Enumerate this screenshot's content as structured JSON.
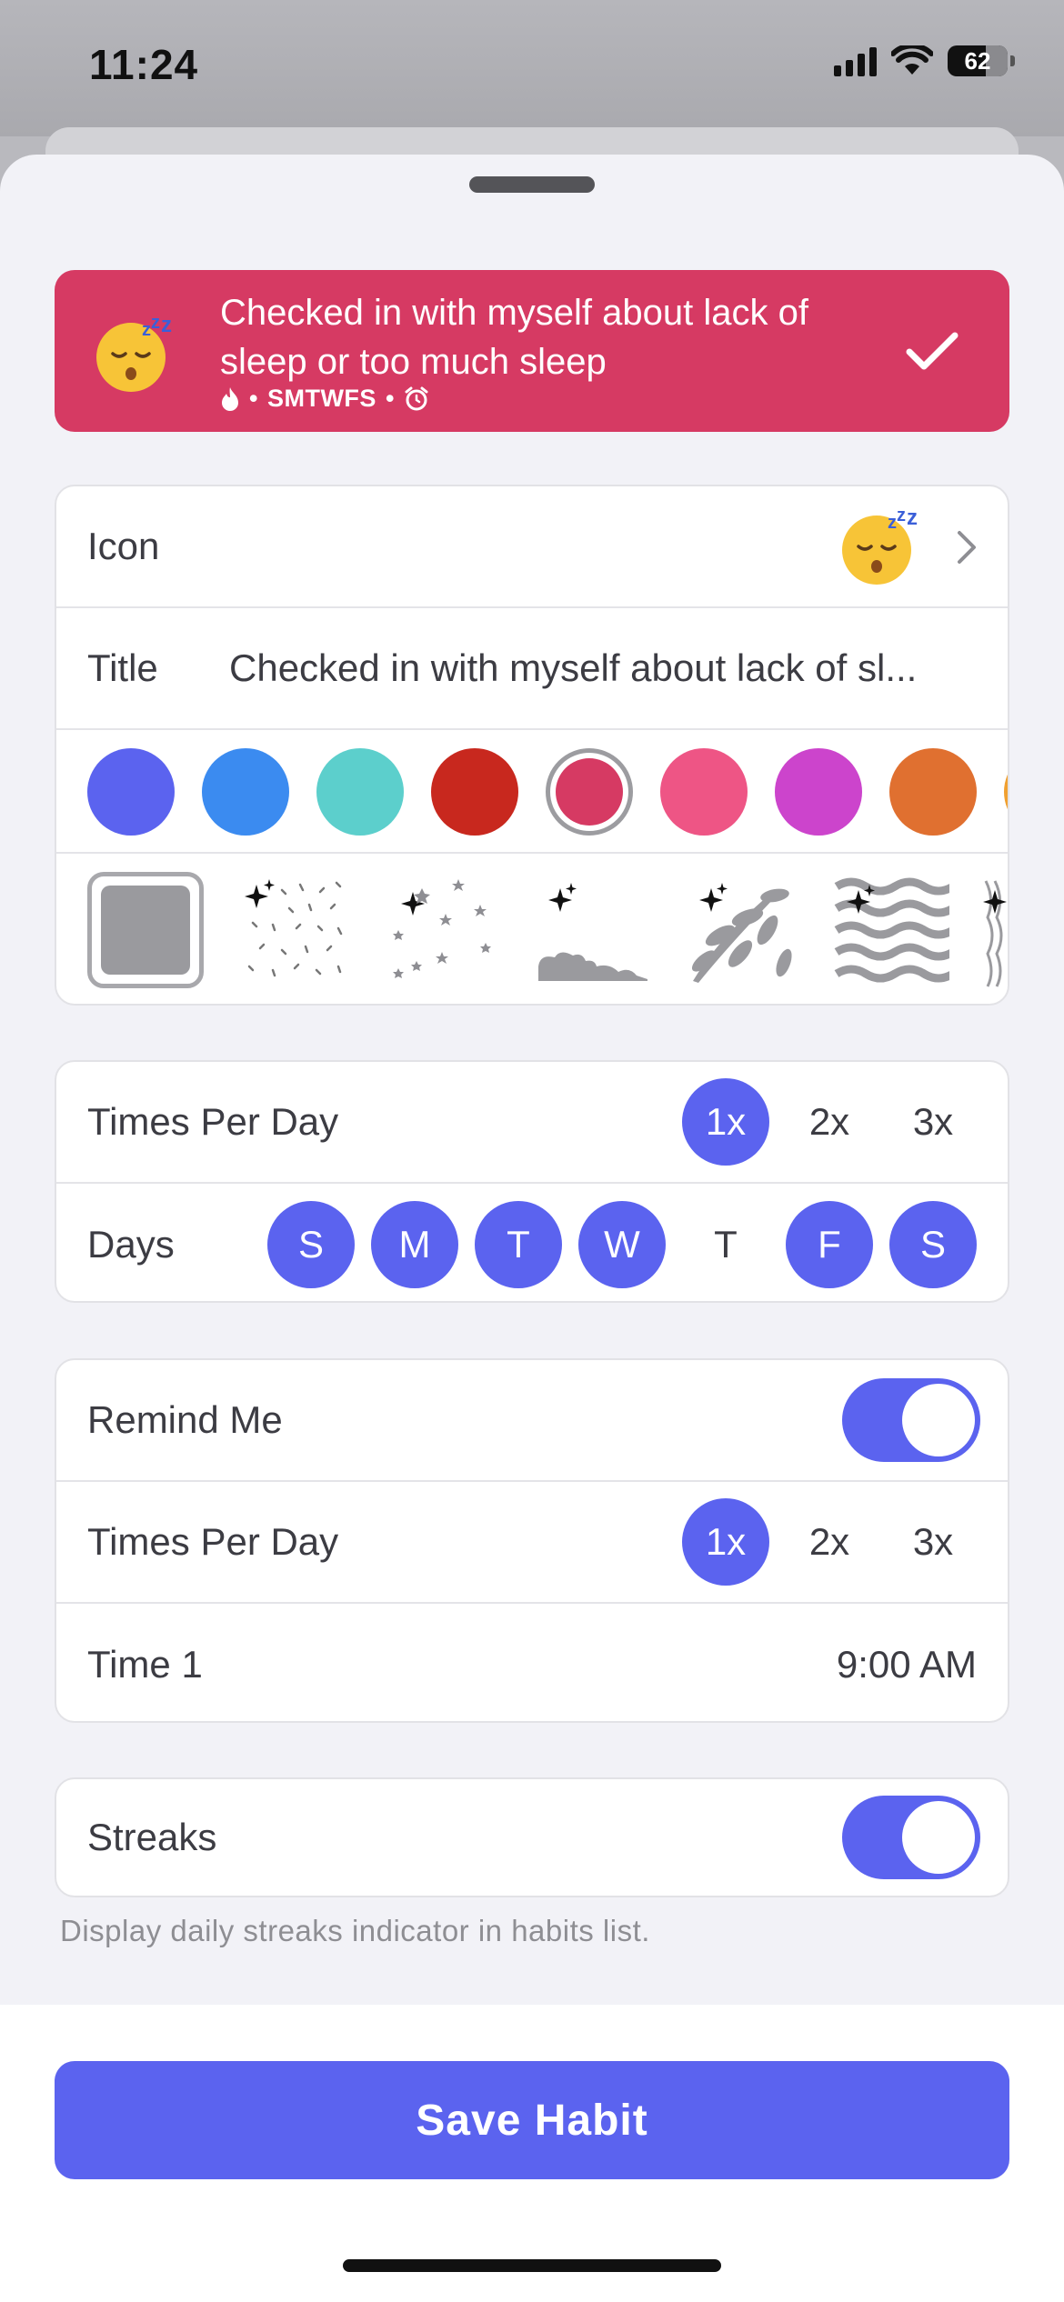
{
  "status_bar": {
    "time": "11:24",
    "battery": "62"
  },
  "banner": {
    "title": "Checked in with myself about lack of sleep or too much sleep",
    "meta_days": "SMTWFS",
    "separator": "•",
    "color": "#d63a63",
    "icons": [
      "sleeping-face-icon",
      "flame-icon",
      "alarm-clock-icon",
      "checkmark-icon"
    ]
  },
  "appearance": {
    "icon_label": "Icon",
    "title_label": "Title",
    "title_value": "Checked in with myself about lack of sl...",
    "colors": [
      "#5b63ef",
      "#3b8bf0",
      "#5ccfcc",
      "#c8281e",
      "#d63a63",
      "#ee5585",
      "#cc44cc",
      "#e07030",
      "#f0a030"
    ],
    "selected_color": "#d63a63",
    "patterns": [
      "solid",
      "confetti-sparkles",
      "stars-sparkles",
      "clouds-sparkles",
      "leaves-sparkles",
      "waves-sparkles",
      "lines-sparkles"
    ],
    "selected_pattern": "solid"
  },
  "schedule": {
    "times_label": "Times Per Day",
    "times_options": [
      "1x",
      "2x",
      "3x"
    ],
    "times_selected": "1x",
    "days_label": "Days",
    "days": [
      {
        "label": "S",
        "on": true
      },
      {
        "label": "M",
        "on": true
      },
      {
        "label": "T",
        "on": true
      },
      {
        "label": "W",
        "on": true
      },
      {
        "label": "T",
        "on": false
      },
      {
        "label": "F",
        "on": true
      },
      {
        "label": "S",
        "on": true
      }
    ]
  },
  "reminders": {
    "remind_label": "Remind Me",
    "remind_on": true,
    "times_label": "Times Per Day",
    "times_options": [
      "1x",
      "2x",
      "3x"
    ],
    "times_selected": "1x",
    "time1_label": "Time 1",
    "time1_value": "9:00 AM"
  },
  "streaks": {
    "label": "Streaks",
    "on": true,
    "note": "Display daily streaks indicator in habits list."
  },
  "save_label": "Save Habit",
  "accent": "#5b63ef"
}
